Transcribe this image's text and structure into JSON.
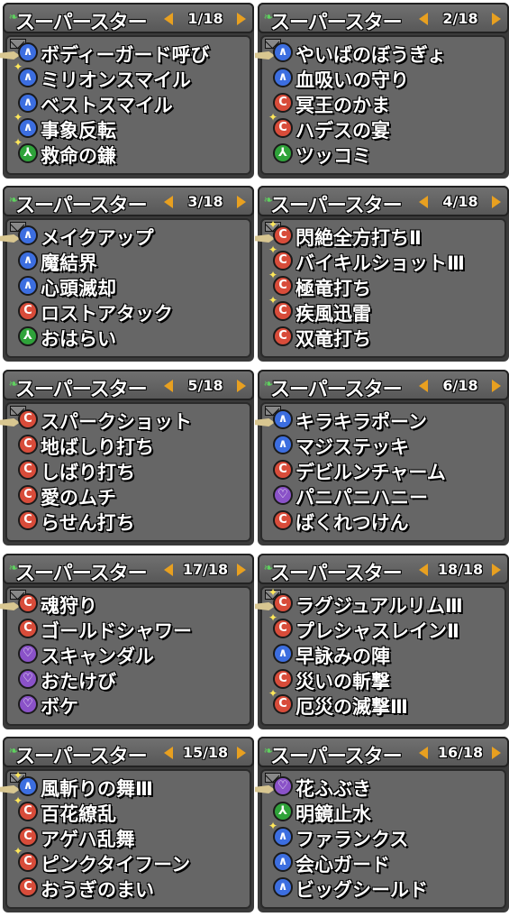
{
  "colors": {
    "blue": "#3c6ee0",
    "red": "#d84c3a",
    "green": "#2fa33a",
    "purple": "#8a52c8",
    "arrow": "#e8a020"
  },
  "panels": [
    {
      "title": "スーパースター",
      "page": "1/18",
      "items": [
        {
          "name": "ボディーガード呼び",
          "color": "blue",
          "spark": false
        },
        {
          "name": "ミリオンスマイル",
          "color": "blue",
          "spark": true
        },
        {
          "name": "ベストスマイル",
          "color": "blue",
          "spark": false
        },
        {
          "name": "事象反転",
          "color": "blue",
          "spark": true
        },
        {
          "name": "救命の鎌",
          "color": "green",
          "spark": true
        }
      ]
    },
    {
      "title": "スーパースター",
      "page": "2/18",
      "items": [
        {
          "name": "やいばのぼうぎょ",
          "color": "blue",
          "spark": false
        },
        {
          "name": "血吸いの守り",
          "color": "blue",
          "spark": false
        },
        {
          "name": "冥王のかま",
          "color": "red",
          "spark": false
        },
        {
          "name": "ハデスの宴",
          "color": "red",
          "spark": true
        },
        {
          "name": "ツッコミ",
          "color": "green",
          "spark": false
        }
      ]
    },
    {
      "title": "スーパースター",
      "page": "3/18",
      "items": [
        {
          "name": "メイクアップ",
          "color": "blue",
          "spark": false
        },
        {
          "name": "魔結界",
          "color": "blue",
          "spark": false
        },
        {
          "name": "心頭滅却",
          "color": "blue",
          "spark": false
        },
        {
          "name": "ロストアタック",
          "color": "red",
          "spark": false
        },
        {
          "name": "おはらい",
          "color": "green",
          "spark": false
        }
      ]
    },
    {
      "title": "スーパースター",
      "page": "4/18",
      "items": [
        {
          "name": "閃絶全方打ちⅡ",
          "color": "red",
          "spark": true
        },
        {
          "name": "バイキルショットⅢ",
          "color": "red",
          "spark": true
        },
        {
          "name": "極竜打ち",
          "color": "red",
          "spark": true
        },
        {
          "name": "疾風迅雷",
          "color": "red",
          "spark": true
        },
        {
          "name": "双竜打ち",
          "color": "red",
          "spark": false
        }
      ]
    },
    {
      "title": "スーパースター",
      "page": "5/18",
      "items": [
        {
          "name": "スパークショット",
          "color": "red",
          "spark": false
        },
        {
          "name": "地ばしり打ち",
          "color": "red",
          "spark": false
        },
        {
          "name": "しばり打ち",
          "color": "red",
          "spark": false
        },
        {
          "name": "愛のムチ",
          "color": "red",
          "spark": false
        },
        {
          "name": "らせん打ち",
          "color": "red",
          "spark": false
        }
      ]
    },
    {
      "title": "スーパースター",
      "page": "6/18",
      "items": [
        {
          "name": "キラキラポーン",
          "color": "blue",
          "spark": false
        },
        {
          "name": "マジステッキ",
          "color": "blue",
          "spark": false
        },
        {
          "name": "デビルンチャーム",
          "color": "red",
          "spark": false
        },
        {
          "name": "パニパニハニー",
          "color": "purple",
          "spark": false
        },
        {
          "name": "ばくれつけん",
          "color": "red",
          "spark": false
        }
      ]
    },
    {
      "title": "スーパースター",
      "page": "17/18",
      "items": [
        {
          "name": "魂狩り",
          "color": "red",
          "spark": false
        },
        {
          "name": "ゴールドシャワー",
          "color": "red",
          "spark": false
        },
        {
          "name": "スキャンダル",
          "color": "purple",
          "spark": false
        },
        {
          "name": "おたけび",
          "color": "purple",
          "spark": false
        },
        {
          "name": "ボケ",
          "color": "purple",
          "spark": false
        }
      ]
    },
    {
      "title": "スーパースター",
      "page": "18/18",
      "items": [
        {
          "name": "ラグジュアルリムⅢ",
          "color": "red",
          "spark": true
        },
        {
          "name": "プレシャスレインⅡ",
          "color": "red",
          "spark": true
        },
        {
          "name": "早詠みの陣",
          "color": "blue",
          "spark": false
        },
        {
          "name": "災いの斬撃",
          "color": "red",
          "spark": false
        },
        {
          "name": "厄災の滅撃Ⅲ",
          "color": "red",
          "spark": true
        }
      ]
    },
    {
      "title": "スーパースター",
      "page": "15/18",
      "items": [
        {
          "name": "風斬りの舞Ⅲ",
          "color": "blue",
          "spark": true
        },
        {
          "name": "百花繚乱",
          "color": "red",
          "spark": true
        },
        {
          "name": "アゲハ乱舞",
          "color": "red",
          "spark": false
        },
        {
          "name": "ピンクタイフーン",
          "color": "red",
          "spark": true
        },
        {
          "name": "おうぎのまい",
          "color": "red",
          "spark": false
        }
      ]
    },
    {
      "title": "スーパースター",
      "page": "16/18",
      "items": [
        {
          "name": "花ふぶき",
          "color": "purple",
          "spark": false
        },
        {
          "name": "明鏡止水",
          "color": "green",
          "spark": false
        },
        {
          "name": "ファランクス",
          "color": "blue",
          "spark": true
        },
        {
          "name": "会心ガード",
          "color": "blue",
          "spark": false
        },
        {
          "name": "ビッグシールド",
          "color": "blue",
          "spark": false
        }
      ]
    }
  ]
}
